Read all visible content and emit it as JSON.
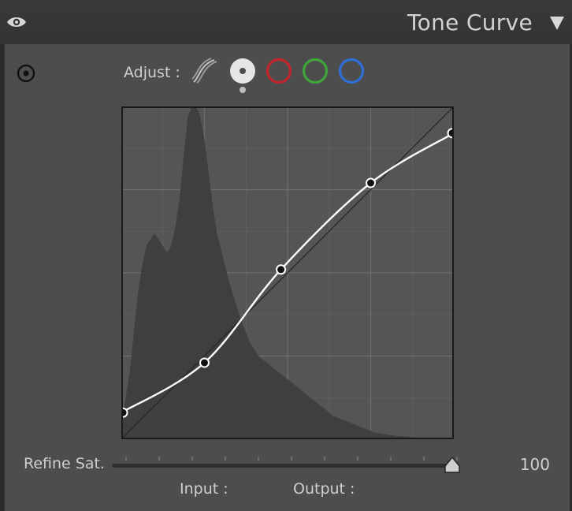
{
  "panel": {
    "title": "Tone Curve",
    "icons": {
      "visibility": "eye-icon",
      "collapse": "triangle-down-icon",
      "target": "target-adjust-icon"
    }
  },
  "adjust": {
    "label": "Adjust :",
    "channels": [
      {
        "name": "parametric",
        "icon": "parametric-curve-icon",
        "selected": false
      },
      {
        "name": "rgb",
        "icon": "white-point-circle-icon",
        "color": "#ffffff",
        "selected": true
      },
      {
        "name": "red",
        "icon": "red-circle-icon",
        "color": "#c0262c",
        "selected": false
      },
      {
        "name": "green",
        "icon": "green-circle-icon",
        "color": "#3fa43a",
        "selected": false
      },
      {
        "name": "blue",
        "icon": "blue-circle-icon",
        "color": "#2f6fd6",
        "selected": false
      }
    ]
  },
  "curve": {
    "points": [
      [
        0,
        0.08
      ],
      [
        0.25,
        0.23
      ],
      [
        0.48,
        0.51
      ],
      [
        0.75,
        0.77
      ],
      [
        1.0,
        0.92
      ]
    ],
    "histogram": [
      0.05,
      0.12,
      0.2,
      0.32,
      0.44,
      0.52,
      0.58,
      0.6,
      0.62,
      0.6,
      0.58,
      0.56,
      0.58,
      0.64,
      0.72,
      0.85,
      0.97,
      1.0,
      1.0,
      0.97,
      0.9,
      0.8,
      0.7,
      0.62,
      0.57,
      0.52,
      0.47,
      0.43,
      0.39,
      0.35,
      0.32,
      0.29,
      0.27,
      0.25,
      0.24,
      0.23,
      0.22,
      0.21,
      0.2,
      0.19,
      0.18,
      0.17,
      0.16,
      0.15,
      0.14,
      0.13,
      0.12,
      0.11,
      0.1,
      0.09,
      0.08,
      0.07,
      0.065,
      0.06,
      0.055,
      0.05,
      0.045,
      0.04,
      0.035,
      0.03,
      0.025,
      0.02,
      0.018,
      0.016,
      0.014,
      0.012,
      0.01,
      0.009,
      0.008,
      0.007,
      0.006,
      0.005,
      0.004,
      0.004,
      0.003,
      0.003,
      0.002,
      0.002,
      0.002,
      0.001,
      0.001
    ],
    "colors": {
      "curve": "#ffffff",
      "grid": "#666666",
      "background": "#555555",
      "histogram": "#3e3e3e"
    }
  },
  "refine": {
    "label": "Refine Sat.",
    "value": "100",
    "level": 1.0
  },
  "io": {
    "input_label": "Input :",
    "output_label": "Output :"
  }
}
